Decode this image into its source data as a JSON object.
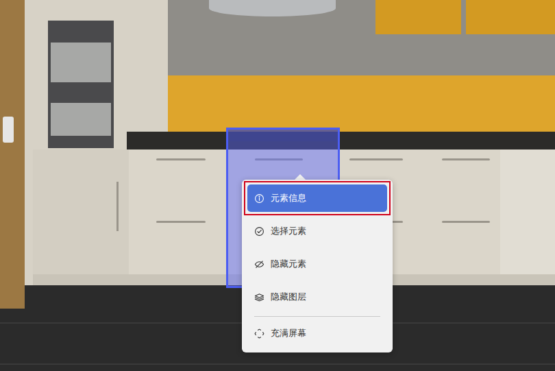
{
  "scene": {
    "element_selected": true
  },
  "menu": {
    "groups": [
      [
        {
          "label": "元素信息",
          "selected": true,
          "outlined": true
        },
        {
          "label": "选择元素",
          "selected": false,
          "outlined": false
        },
        {
          "label": "隐藏元素",
          "selected": false,
          "outlined": false
        },
        {
          "label": "隐藏图层",
          "selected": false,
          "outlined": false
        }
      ],
      [
        {
          "label": "充满屏幕",
          "selected": false,
          "outlined": false
        }
      ]
    ]
  }
}
